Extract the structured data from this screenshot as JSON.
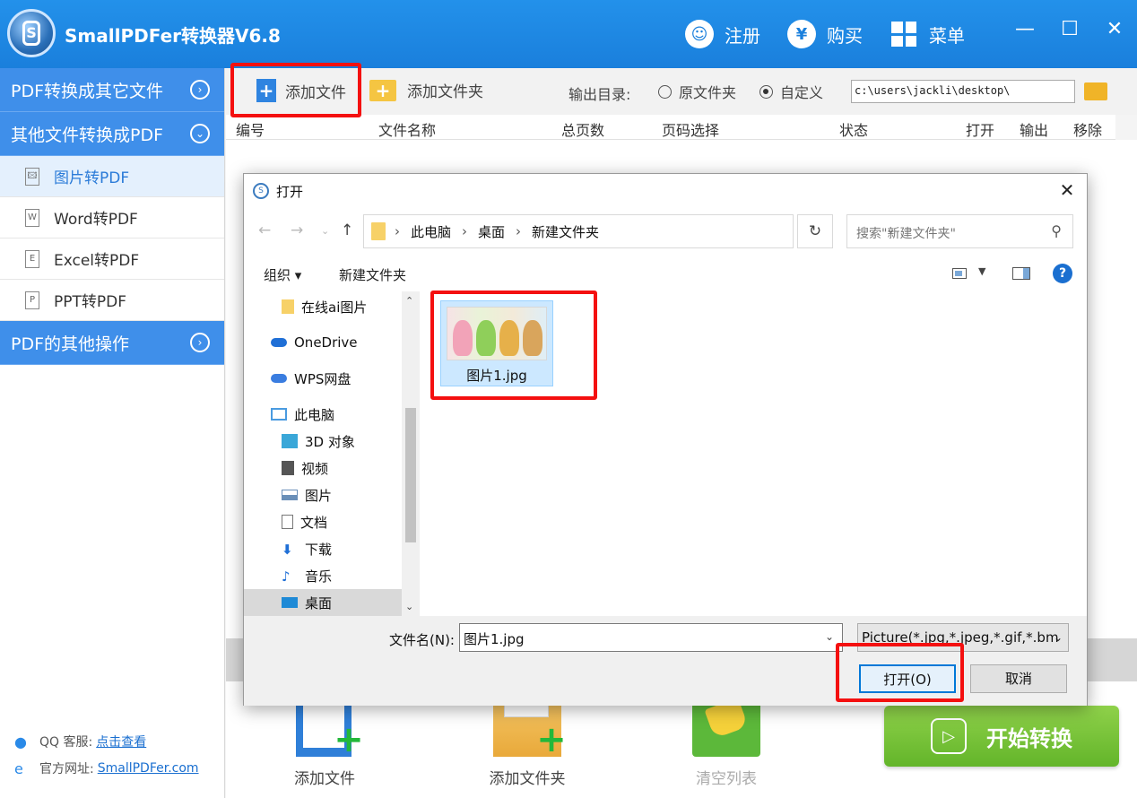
{
  "app": {
    "logo_letter": "S",
    "title": "SmallPDFer转换器V6.8",
    "register": "注册",
    "buy": "购买",
    "buy_symbol": "¥",
    "menu": "菜单",
    "minimize": "—",
    "maximize": "☐",
    "close": "✕"
  },
  "sidebar": {
    "sections": [
      {
        "label": "PDF转换成其它文件",
        "chev": "›"
      },
      {
        "label": "其他文件转换成PDF",
        "chev": "⌄"
      },
      {
        "label": "PDF的其他操作",
        "chev": "›"
      }
    ],
    "items": [
      {
        "label": "图片转PDF",
        "icon": "🖾"
      },
      {
        "label": "Word转PDF",
        "icon": "W"
      },
      {
        "label": "Excel转PDF",
        "icon": "E"
      },
      {
        "label": "PPT转PDF",
        "icon": "P"
      }
    ],
    "footer": {
      "qq_label": "QQ 客服:",
      "qq_link": "点击查看",
      "site_label": "官方网址:",
      "site_link": "SmallPDFer.com"
    }
  },
  "toolbar": {
    "add_file": "添加文件",
    "add_folder": "添加文件夹",
    "output_label": "输出目录:",
    "radio_original": "原文件夹",
    "radio_custom": "自定义",
    "output_path": "c:\\users\\jackli\\desktop\\"
  },
  "columns": [
    "编号",
    "文件名称",
    "总页数",
    "页码选择",
    "状态",
    "打开",
    "输出",
    "移除"
  ],
  "bottom": {
    "add_file": "添加文件",
    "add_folder": "添加文件夹",
    "clear_list": "清空列表",
    "start": "开始转换"
  },
  "dialog": {
    "title": "打开",
    "breadcrumb": [
      "此电脑",
      "桌面",
      "新建文件夹"
    ],
    "search_placeholder": "搜索\"新建文件夹\"",
    "organize": "组织 ▾",
    "new_folder": "新建文件夹",
    "help": "?",
    "tree": [
      {
        "label": "在线ai图片",
        "icon": "folder-icon",
        "color": "#f7d168"
      },
      {
        "label": "OneDrive",
        "icon": "cloud-icon",
        "color": "#1f6fd6"
      },
      {
        "label": "WPS网盘",
        "icon": "cloud-icon",
        "color": "#3a7de0"
      },
      {
        "label": "此电脑",
        "icon": "computer-icon",
        "color": "#4a9be0"
      },
      {
        "label": "3D 对象",
        "icon": "cube-icon",
        "color": "#3aa7d8"
      },
      {
        "label": "视频",
        "icon": "film-icon",
        "color": "#555555"
      },
      {
        "label": "图片",
        "icon": "picture-icon",
        "color": "#6a8fb8"
      },
      {
        "label": "文档",
        "icon": "document-icon",
        "color": "#777777"
      },
      {
        "label": "下载",
        "icon": "download-icon",
        "color": "#1f6fd6"
      },
      {
        "label": "音乐",
        "icon": "music-icon",
        "color": "#1f6fd6"
      },
      {
        "label": "桌面",
        "icon": "desktop-icon",
        "color": "#1f8ad6"
      }
    ],
    "file_name": "图片1.jpg",
    "filename_label": "文件名(N):",
    "filename_value": "图片1.jpg",
    "filetype": "Picture(*.jpg,*.jpeg,*.gif,*.bm",
    "open_btn": "打开(O)",
    "cancel_btn": "取消"
  },
  "colors": {
    "accent": "#1a7fdc",
    "start_green": "#63b52a",
    "highlight_red": "#f41010"
  }
}
